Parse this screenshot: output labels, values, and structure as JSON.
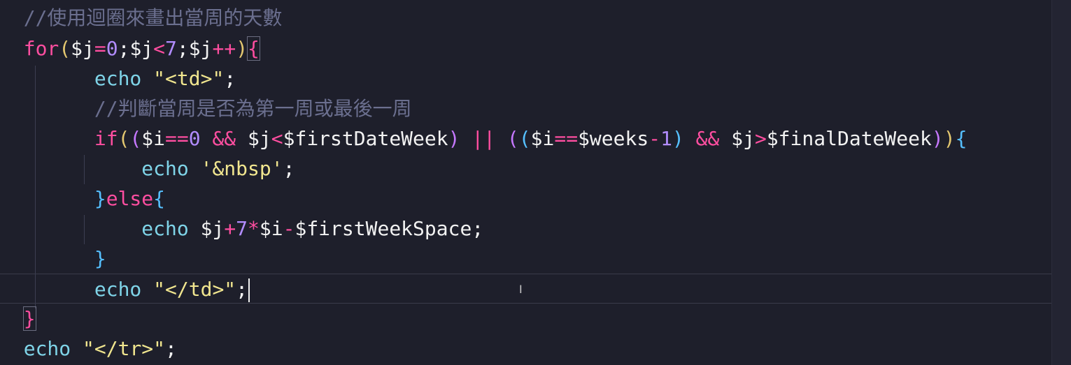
{
  "editor": {
    "line1": "//使用迴圈來畫出當周的天數",
    "line2": {
      "kw": "for",
      "open": "(",
      "var1": "$j",
      "eq": "=",
      "zero": "0",
      "semi1": ";",
      "var2": "$j",
      "lt": "<",
      "seven": "7",
      "semi2": ";",
      "var3": "$j",
      "inc": "++",
      "close": ")",
      "brace": "{"
    },
    "line3": {
      "fn": "echo",
      "str": "\"<td>\"",
      "semi": ";"
    },
    "line4": "//判斷當周是否為第一周或最後一周",
    "line5": {
      "kw": "if",
      "p1": "(",
      "p2": "(",
      "v1": "$i",
      "eqeq1": "==",
      "z": "0",
      "and1": "&&",
      "v2": "$j",
      "lt": "<",
      "v3": "$firstDateWeek",
      "p3": ")",
      "or": "||",
      "p4": "(",
      "p5": "(",
      "v4": "$i",
      "eqeq2": "==",
      "v5": "$weeks",
      "minus": "-",
      "one": "1",
      "p6": ")",
      "and2": "&&",
      "v6": "$j",
      "gt": ">",
      "v7": "$finalDateWeek",
      "p7": ")",
      "p8": ")",
      "brace": "{"
    },
    "line6": {
      "fn": "echo",
      "str": "'&nbsp'",
      "semi": ";"
    },
    "line7": {
      "close": "}",
      "kw": "else",
      "brace": "{"
    },
    "line8": {
      "fn": "echo",
      "v1": "$j",
      "plus": "+",
      "seven": "7",
      "mul": "*",
      "v2": "$i",
      "minus": "-",
      "v3": "$firstWeekSpace",
      "semi": ";"
    },
    "line9": {
      "close": "}"
    },
    "line10": {
      "fn": "echo",
      "str": "\"</td>\"",
      "semi": ";"
    },
    "line11": {
      "close": "}"
    },
    "line12": {
      "fn": "echo",
      "str": "\"</tr>\"",
      "semi": ";"
    }
  }
}
